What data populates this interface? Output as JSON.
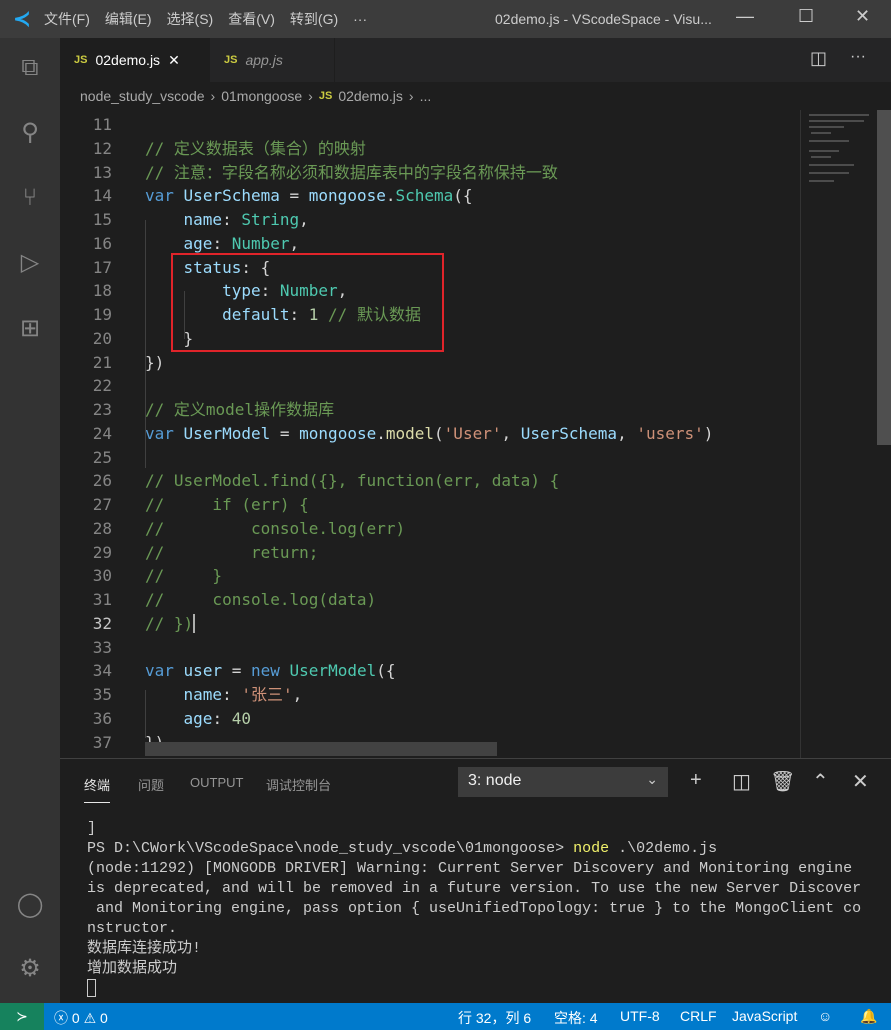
{
  "titlebar": {
    "menus": [
      "文件(F)",
      "编辑(E)",
      "选择(S)",
      "查看(V)",
      "转到(G)",
      "···"
    ],
    "title": "02demo.js - VScodeSpace - Visu..."
  },
  "tabs": [
    {
      "label": "02demo.js",
      "badge": "JS",
      "active": true
    },
    {
      "label": "app.js",
      "badge": "JS",
      "active": false
    }
  ],
  "breadcrumb": [
    "node_study_vscode",
    "01mongoose",
    "02demo.js",
    "..."
  ],
  "breadcrumb_badge": "JS",
  "editor": {
    "current_line": 32,
    "lines": [
      {
        "n": 11,
        "t": []
      },
      {
        "n": 12,
        "t": [
          [
            "// 定义数据表（集合）的映射",
            "c"
          ]
        ]
      },
      {
        "n": 13,
        "t": [
          [
            "// 注意：字段名称必须和数据库表中的字段名称保持一致",
            "c"
          ]
        ]
      },
      {
        "n": 14,
        "t": [
          [
            "var",
            "k"
          ],
          [
            " ",
            "p"
          ],
          [
            "UserSchema",
            "v"
          ],
          [
            " = ",
            "p"
          ],
          [
            "mongoose",
            "v"
          ],
          [
            ".",
            "p"
          ],
          [
            "Schema",
            "t"
          ],
          [
            "({",
            "p"
          ]
        ]
      },
      {
        "n": 15,
        "t": [
          [
            "    ",
            "p"
          ],
          [
            "name",
            "v"
          ],
          [
            ": ",
            "p"
          ],
          [
            "String",
            "t"
          ],
          [
            ",",
            "p"
          ]
        ]
      },
      {
        "n": 16,
        "t": [
          [
            "    ",
            "p"
          ],
          [
            "age",
            "v"
          ],
          [
            ": ",
            "p"
          ],
          [
            "Number",
            "t"
          ],
          [
            ",",
            "p"
          ]
        ]
      },
      {
        "n": 17,
        "t": [
          [
            "    ",
            "p"
          ],
          [
            "status",
            "v"
          ],
          [
            ": {",
            "p"
          ]
        ]
      },
      {
        "n": 18,
        "t": [
          [
            "        ",
            "p"
          ],
          [
            "type",
            "v"
          ],
          [
            ": ",
            "p"
          ],
          [
            "Number",
            "t"
          ],
          [
            ",",
            "p"
          ]
        ]
      },
      {
        "n": 19,
        "t": [
          [
            "        ",
            "p"
          ],
          [
            "default",
            "v"
          ],
          [
            ": ",
            "p"
          ],
          [
            "1",
            "n"
          ],
          [
            " ",
            "p"
          ],
          [
            "// 默认数据",
            "c"
          ]
        ]
      },
      {
        "n": 20,
        "t": [
          [
            "    }",
            "p"
          ]
        ]
      },
      {
        "n": 21,
        "t": [
          [
            "})",
            "p"
          ]
        ]
      },
      {
        "n": 22,
        "t": []
      },
      {
        "n": 23,
        "t": [
          [
            "// 定义model操作数据库",
            "c"
          ]
        ]
      },
      {
        "n": 24,
        "t": [
          [
            "var",
            "k"
          ],
          [
            " ",
            "p"
          ],
          [
            "UserModel",
            "v"
          ],
          [
            " = ",
            "p"
          ],
          [
            "mongoose",
            "v"
          ],
          [
            ".",
            "p"
          ],
          [
            "model",
            "f"
          ],
          [
            "(",
            "p"
          ],
          [
            "'User'",
            "s"
          ],
          [
            ", ",
            "p"
          ],
          [
            "UserSchema",
            "v"
          ],
          [
            ", ",
            "p"
          ],
          [
            "'users'",
            "s"
          ],
          [
            ")",
            "p"
          ]
        ]
      },
      {
        "n": 25,
        "t": []
      },
      {
        "n": 26,
        "t": [
          [
            "// UserModel.find({}, function(err, data) {",
            "c"
          ]
        ]
      },
      {
        "n": 27,
        "t": [
          [
            "//     if (err) {",
            "c"
          ]
        ]
      },
      {
        "n": 28,
        "t": [
          [
            "//         console.log(err)",
            "c"
          ]
        ]
      },
      {
        "n": 29,
        "t": [
          [
            "//         return;",
            "c"
          ]
        ]
      },
      {
        "n": 30,
        "t": [
          [
            "//     }",
            "c"
          ]
        ]
      },
      {
        "n": 31,
        "t": [
          [
            "//     console.log(data)",
            "c"
          ]
        ]
      },
      {
        "n": 32,
        "t": [
          [
            "// })",
            "c"
          ]
        ]
      },
      {
        "n": 33,
        "t": []
      },
      {
        "n": 34,
        "t": [
          [
            "var",
            "k"
          ],
          [
            " ",
            "p"
          ],
          [
            "user",
            "v"
          ],
          [
            " = ",
            "p"
          ],
          [
            "new",
            "k"
          ],
          [
            " ",
            "p"
          ],
          [
            "UserModel",
            "t"
          ],
          [
            "({",
            "p"
          ]
        ]
      },
      {
        "n": 35,
        "t": [
          [
            "    ",
            "p"
          ],
          [
            "name",
            "v"
          ],
          [
            ": ",
            "p"
          ],
          [
            "'张三'",
            "s"
          ],
          [
            ",",
            "p"
          ]
        ]
      },
      {
        "n": 36,
        "t": [
          [
            "    ",
            "p"
          ],
          [
            "age",
            "v"
          ],
          [
            ": ",
            "p"
          ],
          [
            "40",
            "n"
          ]
        ]
      },
      {
        "n": 37,
        "t": [
          [
            "})",
            "p"
          ]
        ]
      }
    ]
  },
  "panel": {
    "tabs": [
      "终端",
      "问题",
      "OUTPUT",
      "调试控制台"
    ],
    "terminal_select": "3: node",
    "terminal": {
      "l1": "]",
      "prompt": "PS D:\\CWork\\VScodeSpace\\node_study_vscode\\01mongoose> ",
      "cmd": "node",
      "args": " .\\02demo.js",
      "l3": "(node:11292) [MONGODB DRIVER] Warning: Current Server Discovery and Monitoring engine",
      "l4": "is deprecated, and will be removed in a future version. To use the new Server Discover",
      "l5": " and Monitoring engine, pass option { useUnifiedTopology: true } to the MongoClient co",
      "l6": "nstructor.",
      "l7": "数据库连接成功!",
      "l8": "增加数据成功"
    }
  },
  "status": {
    "errors": "0",
    "warnings": "0",
    "position": "行 32，列 6",
    "spaces": "空格: 4",
    "encoding": "UTF-8",
    "eol": "CRLF",
    "language": "JavaScript"
  },
  "colors": {
    "statusbar": "#007acc",
    "highlight_box": "#e0242a"
  }
}
